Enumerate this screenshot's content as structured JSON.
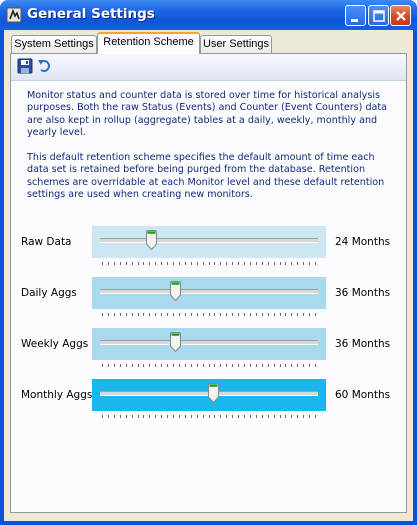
{
  "window": {
    "title": "General Settings"
  },
  "tabs": [
    {
      "label": "System Settings",
      "active": false
    },
    {
      "label": "Retention Scheme",
      "active": true
    },
    {
      "label": "User Settings",
      "active": false
    }
  ],
  "toolbar": {
    "save_icon": "save-icon",
    "undo_icon": "undo-icon"
  },
  "description": {
    "paragraph1": "Monitor status and counter data is stored over time for historical analysis purposes. Both the raw Status (Events) and Counter (Event Counters) data are also kept in rollup (aggregate) tables at a daily, weekly, monthly and yearly level.",
    "paragraph2": "This default retention scheme specifies the default amount of time each data set is retained before being purged from the database. Retention schemes are overridable at each Monitor level and these default retention settings are used when creating new monitors."
  },
  "sliders": [
    {
      "label": "Raw Data",
      "value_text": "24 Months",
      "position": 0.23,
      "bg": "#cde7f2"
    },
    {
      "label": "Daily Aggs",
      "value_text": "36 Months",
      "position": 0.34,
      "bg": "#a9d9ec"
    },
    {
      "label": "Weekly Aggs",
      "value_text": "36 Months",
      "position": 0.34,
      "bg": "#a9d9ec"
    },
    {
      "label": "Monthly Aggs",
      "value_text": "60 Months",
      "position": 0.52,
      "bg": "#19b7ee"
    }
  ],
  "colors": {
    "title_bar": "#0a53d8",
    "description_text": "#102a7a",
    "active_tab_accent": "#f5a623"
  }
}
